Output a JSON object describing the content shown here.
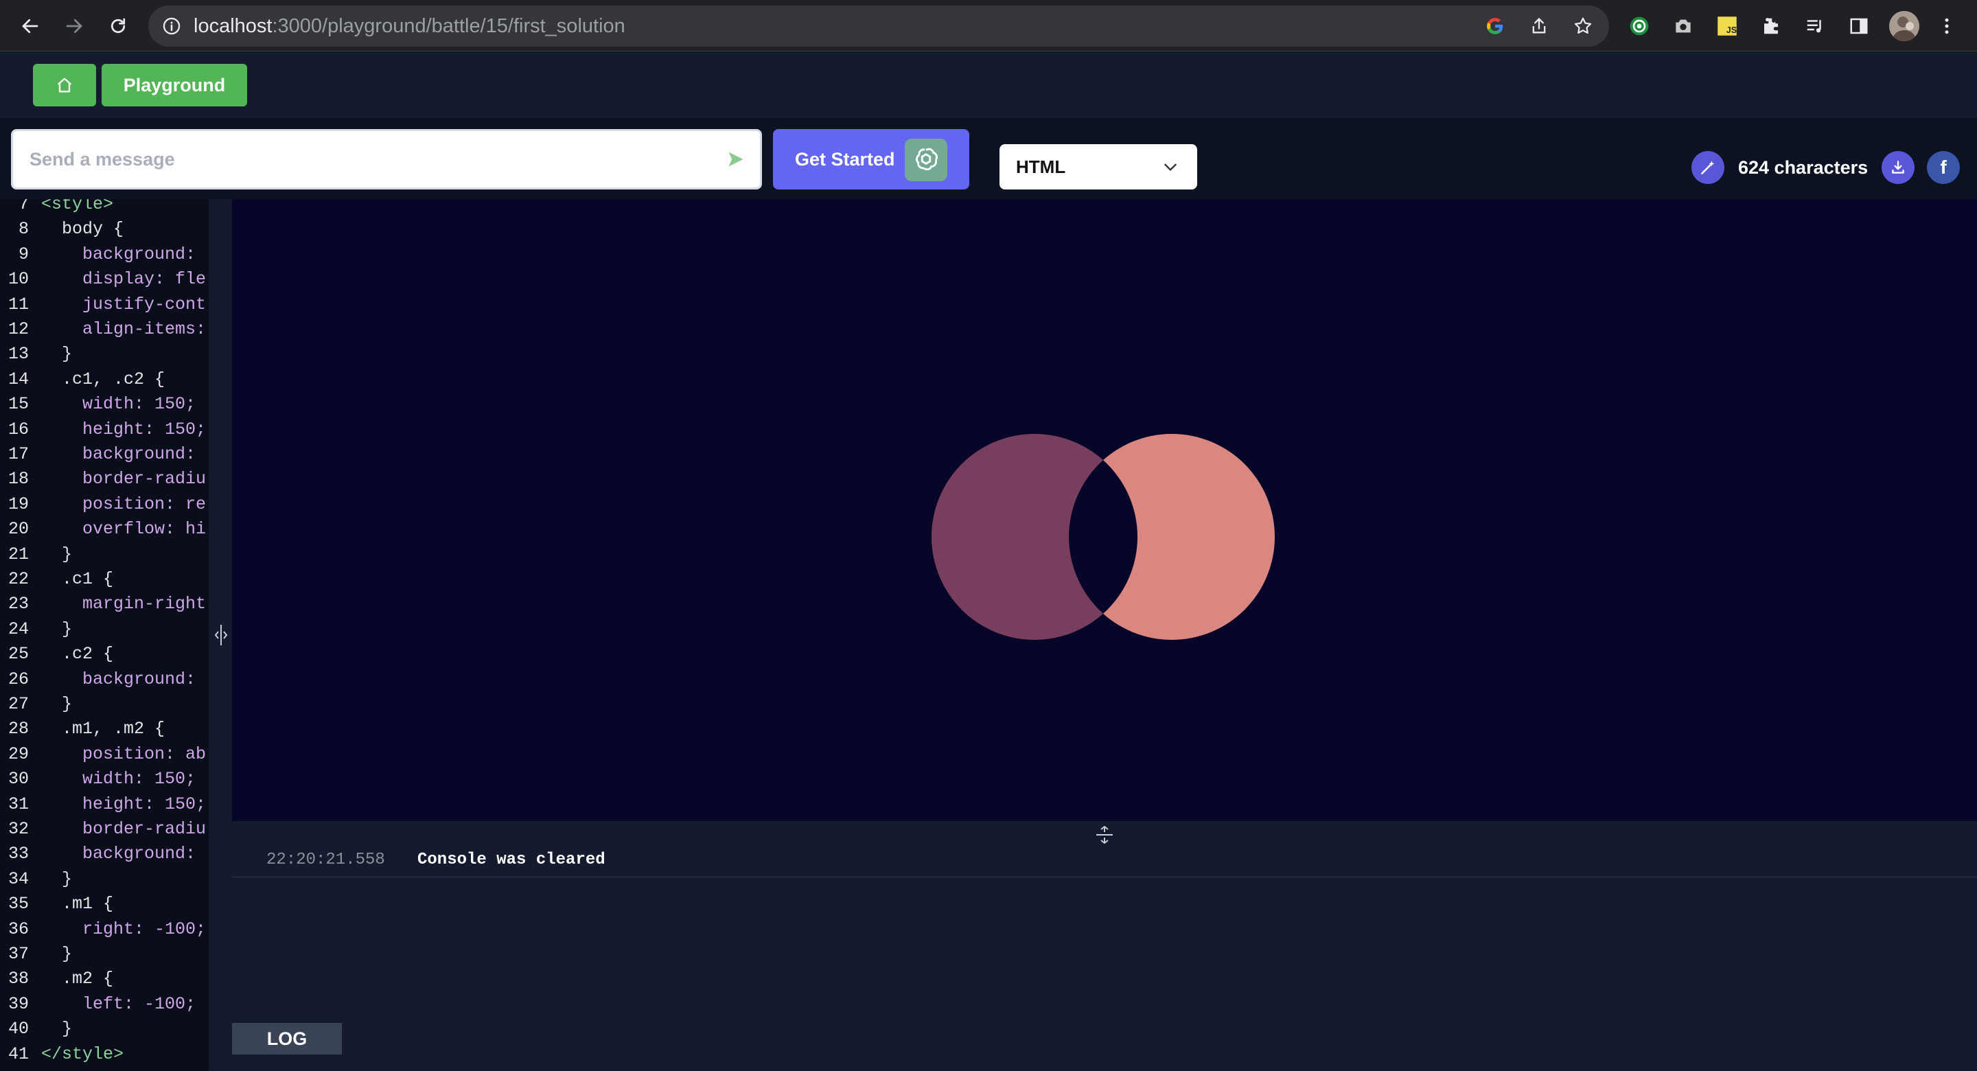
{
  "browser": {
    "url_host": "localhost",
    "url_path": ":3000/playground/battle/15/first_solution"
  },
  "header": {
    "playground_label": "Playground"
  },
  "toolbar": {
    "message_placeholder": "Send a message",
    "get_started_label": "Get Started",
    "language": "HTML",
    "char_count": "624 characters",
    "facebook_glyph": "f"
  },
  "editor": {
    "lines": [
      {
        "n": "7",
        "text": "<style>"
      },
      {
        "n": "8",
        "text": "  body {"
      },
      {
        "n": "9",
        "text": "    background:"
      },
      {
        "n": "10",
        "text": "    display: fle"
      },
      {
        "n": "11",
        "text": "    justify-cont"
      },
      {
        "n": "12",
        "text": "    align-items:"
      },
      {
        "n": "13",
        "text": "  }"
      },
      {
        "n": "14",
        "text": "  .c1, .c2 {"
      },
      {
        "n": "15",
        "text": "    width: 150;"
      },
      {
        "n": "16",
        "text": "    height: 150;"
      },
      {
        "n": "17",
        "text": "    background:"
      },
      {
        "n": "18",
        "text": "    border-radiu"
      },
      {
        "n": "19",
        "text": "    position: re"
      },
      {
        "n": "20",
        "text": "    overflow: hi"
      },
      {
        "n": "21",
        "text": "  }"
      },
      {
        "n": "22",
        "text": "  .c1 {"
      },
      {
        "n": "23",
        "text": "    margin-right"
      },
      {
        "n": "24",
        "text": "  }"
      },
      {
        "n": "25",
        "text": "  .c2 {"
      },
      {
        "n": "26",
        "text": "    background:"
      },
      {
        "n": "27",
        "text": "  }"
      },
      {
        "n": "28",
        "text": "  .m1, .m2 {"
      },
      {
        "n": "29",
        "text": "    position: ab"
      },
      {
        "n": "30",
        "text": "    width: 150;"
      },
      {
        "n": "31",
        "text": "    height: 150;"
      },
      {
        "n": "32",
        "text": "    border-radiu"
      },
      {
        "n": "33",
        "text": "    background:"
      },
      {
        "n": "34",
        "text": "  }"
      },
      {
        "n": "35",
        "text": "  .m1 {"
      },
      {
        "n": "36",
        "text": "    right: -100;"
      },
      {
        "n": "37",
        "text": "  }"
      },
      {
        "n": "38",
        "text": "  .m2 {"
      },
      {
        "n": "39",
        "text": "    left: -100;"
      },
      {
        "n": "40",
        "text": "  }"
      },
      {
        "n": "41",
        "text": "</style>"
      }
    ]
  },
  "preview": {
    "background": "#070628",
    "left_circle_color": "#773f5d",
    "right_circle_color": "#da8782"
  },
  "console": {
    "timestamp": "22:20:21.558",
    "message": "Console was cleared",
    "log_label": "LOG"
  }
}
